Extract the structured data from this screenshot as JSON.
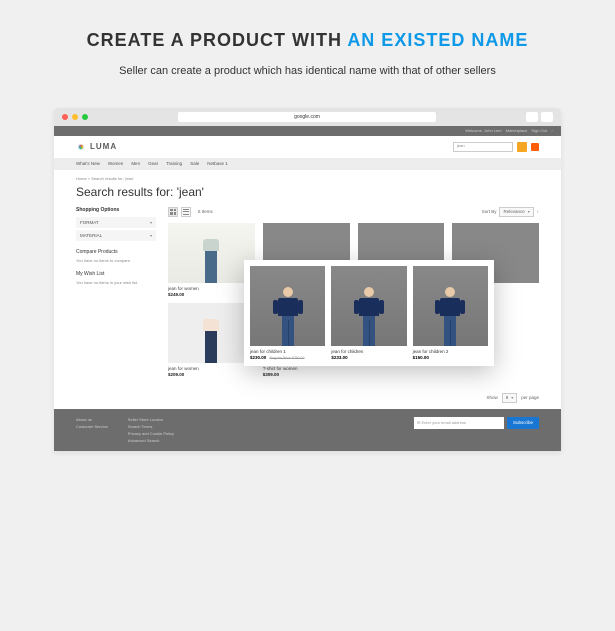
{
  "promo": {
    "title_part1": "CREATE A PRODUCT WITH ",
    "title_part2": "AN EXISTED NAME",
    "subtitle": "Seller can create a product which has identical name with that of other sellers"
  },
  "browser": {
    "url": "google.com"
  },
  "topbar": {
    "welcome": "Welcome, John Lee!",
    "marketplace": "Marketplace",
    "signout": "Sign Out"
  },
  "logo": {
    "text": "LUMA"
  },
  "search": {
    "value": "jean"
  },
  "nav": [
    "What's New",
    "Women",
    "Men",
    "Gear",
    "Training",
    "Sale",
    "Netbase 1"
  ],
  "crumbs": "Home  >  Search results for: 'jean'",
  "page_title": "Search results for: 'jean'",
  "sidebar": {
    "shopping_options": "Shopping Options",
    "filters": [
      "FORMAT",
      "MATERIAL"
    ],
    "compare_title": "Compare Products",
    "compare_text": "You have no items to compare.",
    "wishlist_title": "My Wish List",
    "wishlist_text": "You have no items in your wish list."
  },
  "toolbar": {
    "count": "6 Items",
    "sort_label": "Sort By",
    "sort_value": "Relevance"
  },
  "products": [
    {
      "name": "jean for women",
      "price": "$249.00"
    },
    {
      "name": "jean for children 1",
      "price": "$230.00",
      "old_label": "Regular Price",
      "old_price": "$250.00"
    },
    {
      "name": "jean for children",
      "price": "$233.00"
    },
    {
      "name": "jean for children 2",
      "price": "$150.00"
    },
    {
      "name": "jean for women",
      "price": "$209.00"
    },
    {
      "name": "T-shirt for women",
      "price": "$309.00"
    }
  ],
  "highlight": [
    {
      "name": "jean for children 1",
      "price": "$230.00",
      "old_label": "Regular Price",
      "old_price": "$250.00"
    },
    {
      "name": "jean for children",
      "price": "$233.00"
    },
    {
      "name": "jean for children 2",
      "price": "$150.00"
    }
  ],
  "pager": {
    "show": "Show",
    "value": "9",
    "per_page": "per page"
  },
  "footer": {
    "col1": [
      "About us",
      "Customer Service"
    ],
    "col2": [
      "Seller Store Locator",
      "Search Terms",
      "Privacy and Cookie Policy",
      "Advanced Search"
    ],
    "placeholder": "Enter your email address",
    "subscribe": "Subscribe"
  }
}
